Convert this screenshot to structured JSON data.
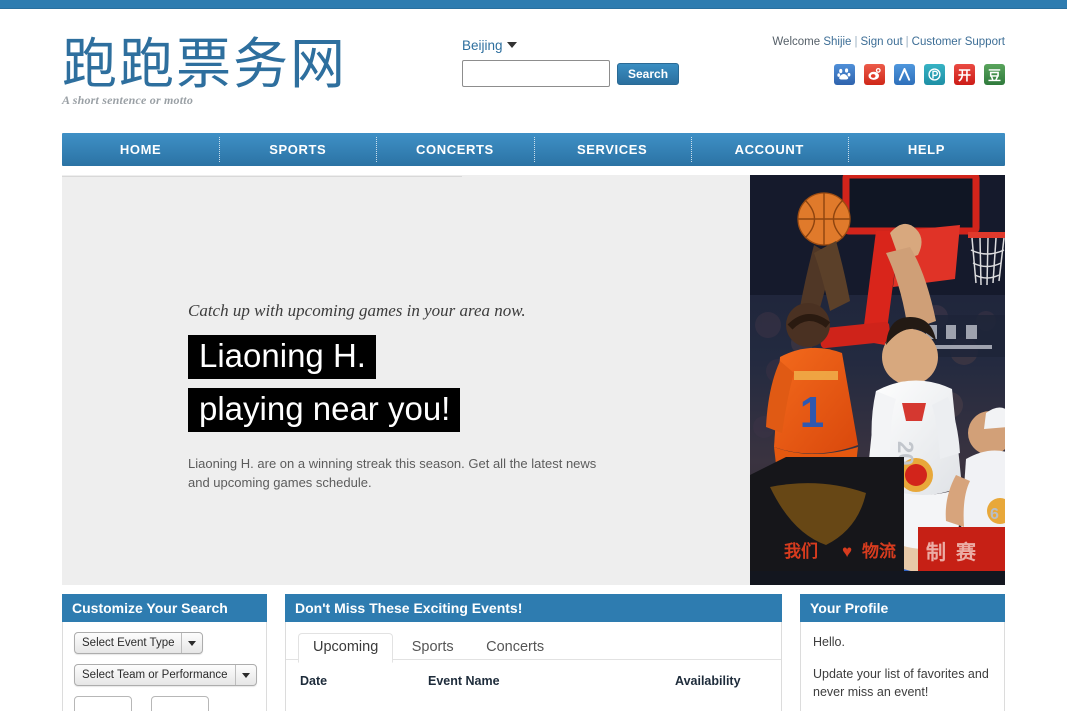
{
  "brand": {
    "logo_text": "跑跑票务网",
    "motto": "A short sentence or motto"
  },
  "search": {
    "city_label": "Beijing",
    "input_value": "",
    "input_placeholder": "",
    "button_label": "Search"
  },
  "account": {
    "welcome_prefix": "Welcome ",
    "user_name": "Shijie",
    "sign_out": "Sign out",
    "customer_support": "Customer Support",
    "separator": "|"
  },
  "social": [
    {
      "name": "baidu",
      "glyph": "du",
      "color": "#2f63ad"
    },
    {
      "name": "weibo",
      "glyph": "",
      "color": "#cf2718"
    },
    {
      "name": "renren",
      "glyph": "人",
      "color": "#2e6fba"
    },
    {
      "name": "pengyou",
      "glyph": "",
      "color": "#1e8fa5"
    },
    {
      "name": "kaixin",
      "glyph": "开",
      "color": "#cc1c17"
    },
    {
      "name": "douban",
      "glyph": "豆",
      "color": "#2f7a3c"
    }
  ],
  "nav": {
    "items": [
      {
        "label": "HOME"
      },
      {
        "label": "SPORTS"
      },
      {
        "label": "CONCERTS"
      },
      {
        "label": "SERVICES"
      },
      {
        "label": "ACCOUNT"
      },
      {
        "label": "HELP"
      }
    ]
  },
  "hero": {
    "kicker": "Catch up with upcoming games in your area now.",
    "title_line1": "Liaoning H.",
    "title_line2": "playing near you!",
    "body": "Liaoning H. are on a winning streak this season. Get all the latest news and upcoming games schedule.",
    "photo_alt": "basketball-game-photo"
  },
  "panels": {
    "search_filter": {
      "title": "Customize Your Search",
      "event_type_label": "Select Event Type",
      "team_label": "Select Team or Performance",
      "date_from_value": "",
      "date_to_value": ""
    },
    "events": {
      "title": "Don't Miss These Exciting Events!",
      "tabs": [
        {
          "label": "Upcoming",
          "active": true
        },
        {
          "label": "Sports",
          "active": false
        },
        {
          "label": "Concerts",
          "active": false
        }
      ],
      "columns": {
        "date": "Date",
        "name": "Event Name",
        "availability": "Availability"
      }
    },
    "profile": {
      "title": "Your Profile",
      "greeting": "Hello.",
      "message": "Update your list of favorites and never miss an event!"
    }
  },
  "colors": {
    "brand_blue": "#2e7cb0",
    "nav_blue": "#3f90c6",
    "logo_blue": "#2e6f9e",
    "hero_bg": "#eeeeee",
    "highlight_black": "#000000"
  }
}
